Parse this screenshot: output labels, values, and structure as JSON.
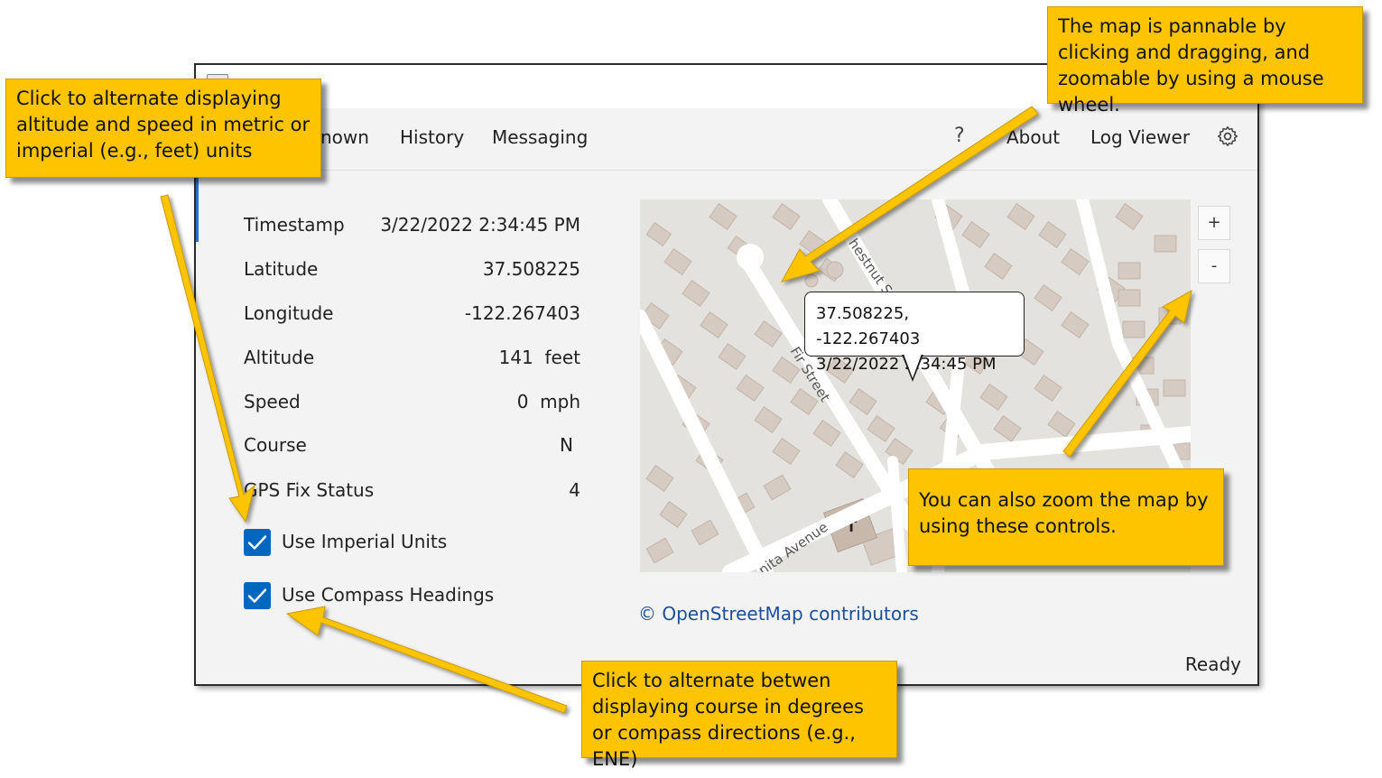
{
  "nav": {
    "items": [
      "Unknown",
      "History",
      "Messaging"
    ],
    "visible_first": "nown",
    "help": "?",
    "about": "About",
    "log_viewer": "Log Viewer"
  },
  "fields": [
    {
      "label": "Timestamp",
      "value": "3/22/2022 2:34:45 PM"
    },
    {
      "label": "Latitude",
      "value": "37.508225"
    },
    {
      "label": "Longitude",
      "value": "-122.267403"
    },
    {
      "label": "Altitude",
      "value": "141  feet"
    },
    {
      "label": "Speed",
      "value": "0  mph"
    },
    {
      "label": "Course",
      "value": "N"
    },
    {
      "label": "GPS Fix Status",
      "value": "4"
    }
  ],
  "options": {
    "imperial": {
      "label": "Use Imperial Units",
      "checked": true
    },
    "compass": {
      "label": "Use Compass Headings",
      "checked": true
    }
  },
  "map": {
    "tooltip_line1": "37.508225, -122.267403",
    "tooltip_line2": "3/22/2022 2:34:45 PM",
    "streets": [
      "hestnut St",
      "Fir Street",
      "nita Avenue"
    ],
    "zoom_in": "+",
    "zoom_out": "-",
    "credit": "© OpenStreetMap contributors"
  },
  "status": "Ready",
  "callouts": {
    "units": "Click to alternate displaying altitude and speed in metric or imperial (e.g., feet) units",
    "pan": "The map is pannable by clicking and dragging, and zoomable by using a mouse wheel.",
    "zoom": "You can also zoom the map by using these controls.",
    "course": "Click to alternate betwen displaying course in degrees or compass directions (e.g., ENE)"
  },
  "colors": {
    "callout": "#ffc400",
    "checkbox": "#0067c0",
    "link": "#1a4f9c",
    "map_bg": "#e4e2de",
    "building": "#d6cbc2"
  }
}
